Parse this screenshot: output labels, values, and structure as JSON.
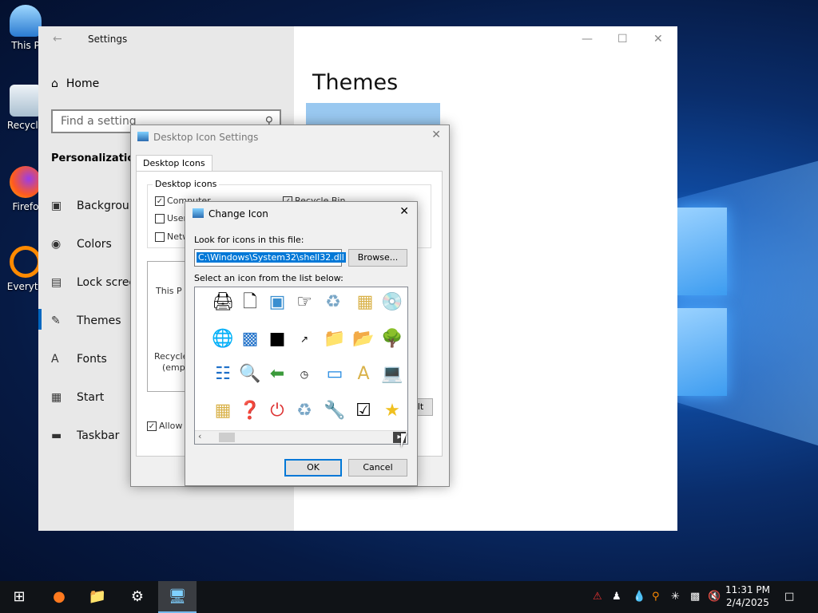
{
  "desktop": {
    "icons": [
      {
        "label": "This PC",
        "short": "This P"
      },
      {
        "label": "Recycle Bin",
        "short": "Recycle"
      },
      {
        "label": "Firefox",
        "short": "Firefo"
      },
      {
        "label": "Everything",
        "short": "Everyth"
      }
    ]
  },
  "settings": {
    "title": "Settings",
    "home": "Home",
    "search_placeholder": "Find a setting",
    "section": "Personalization",
    "nav": [
      "Background",
      "Colors",
      "Lock screen",
      "Themes",
      "Fonts",
      "Start",
      "Taskbar"
    ],
    "nav_visible": [
      "Backgroun",
      "Colors",
      "Lock screer",
      "Themes",
      "Fonts",
      "Start",
      "Taskbar"
    ],
    "selected": "Themes",
    "page_title": "Themes"
  },
  "desktop_icon_settings": {
    "title": "Desktop Icon Settings",
    "tab": "Desktop Icons",
    "group_label": "Desktop icons",
    "checkboxes": [
      {
        "label": "Computer",
        "checked": true
      },
      {
        "label": "User",
        "checked": false
      },
      {
        "label": "Netw",
        "checked": false
      },
      {
        "label": "Recycle Bin",
        "checked": true
      }
    ],
    "icons": [
      "This P",
      "Recycle",
      "(empt"
    ],
    "allow_label": "Allow t",
    "restore_label": "ult"
  },
  "change_icon": {
    "title": "Change Icon",
    "file_label": "Look for icons in this file:",
    "file_value": "C:\\Windows\\System32\\shell32.dll",
    "browse": "Browse...",
    "list_label": "Select an icon from the list below:",
    "ok": "OK",
    "cancel": "Cancel"
  },
  "taskbar": {
    "time": "11:31 PM",
    "date": "2/4/2025"
  },
  "colors": {
    "accent": "#0078d7",
    "taskbar": "#101317"
  }
}
